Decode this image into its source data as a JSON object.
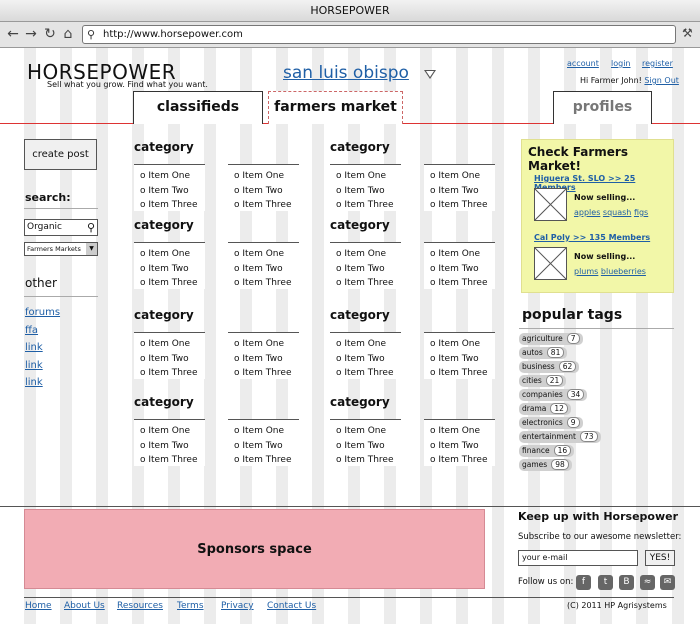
{
  "window": {
    "title": "HORSEPOWER",
    "url": "http://www.horsepower.com"
  },
  "header": {
    "logo": "HORSEPOWER",
    "tagline": "Sell what you grow. Find what you want.",
    "city": "san luis obispo",
    "account": "account",
    "login": "login",
    "register": "register",
    "greeting": "Hi Farmer John!",
    "signout": "Sign Out"
  },
  "tabs": {
    "classifieds": "classifieds",
    "farmers_market": "farmers market",
    "profiles": "profiles"
  },
  "sidebar": {
    "create_post": "create post",
    "search_label": "search:",
    "search_value": "Organic",
    "select_value": "Farmers Markets",
    "other_label": "other",
    "links": [
      "forums",
      "ffa",
      "link",
      "link",
      "link"
    ]
  },
  "categories": {
    "heading": "category",
    "items": [
      "Item One",
      "Item Two",
      "Item Three"
    ]
  },
  "promo": {
    "title": "Check Farmers Market!",
    "markets": [
      {
        "link": "Higuera St. SLO >> 25 Members",
        "selling": "Now selling...",
        "products": [
          "apples",
          "squash",
          "figs"
        ]
      },
      {
        "link": "Cal Poly >> 135 Members",
        "selling": "Now selling...",
        "products": [
          "plums",
          "blueberries"
        ]
      }
    ]
  },
  "popular_tags": {
    "title": "popular tags",
    "tags": [
      {
        "name": "agriculture",
        "count": "7"
      },
      {
        "name": "autos",
        "count": "81"
      },
      {
        "name": "business",
        "count": "62"
      },
      {
        "name": "cities",
        "count": "21"
      },
      {
        "name": "companies",
        "count": "34"
      },
      {
        "name": "drama",
        "count": "12"
      },
      {
        "name": "electronics",
        "count": "9"
      },
      {
        "name": "entertainment",
        "count": "73"
      },
      {
        "name": "finance",
        "count": "16"
      },
      {
        "name": "games",
        "count": "98"
      }
    ]
  },
  "sponsors": "Sponsors space",
  "newsletter": {
    "title": "Keep up with Horsepower",
    "subtitle": "Subscribe to our awesome newsletter:",
    "placeholder": "your e-mail",
    "submit": "YES!",
    "follow": "Follow us on:"
  },
  "footer": {
    "links": [
      "Home",
      "About Us",
      "Resources",
      "Terms",
      "Privacy",
      "Contact Us"
    ],
    "copyright": "(C) 2011 HP Agrisystems"
  },
  "colors": {
    "promo_bg": "#f2f7a8",
    "sponsor_bg": "#f2acb4",
    "link": "#1f5fa6",
    "rule": "#dd3333"
  }
}
